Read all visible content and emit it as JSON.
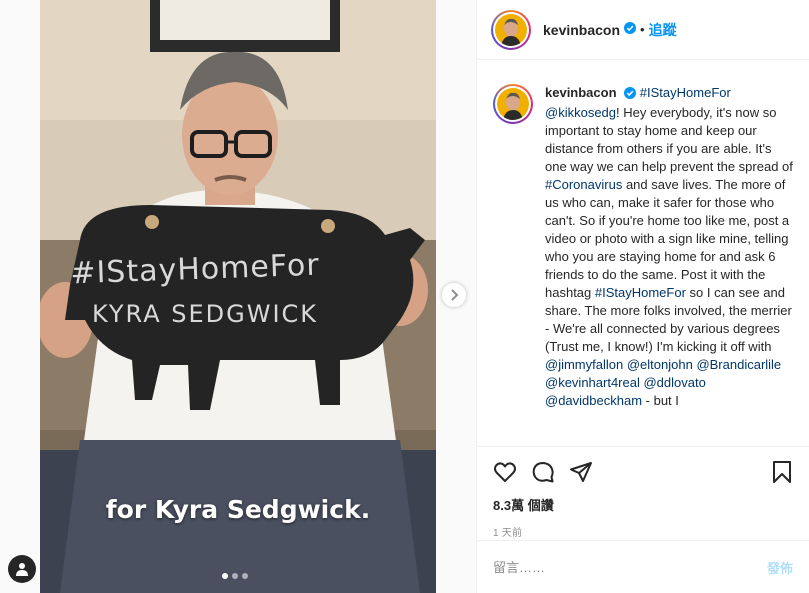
{
  "media": {
    "sign_line1": "#IStayHomeFor",
    "sign_line2": "KYRA SEDGWICK",
    "subtitle": "for Kyra Sedgwick.",
    "carousel_count": 3,
    "carousel_active": 1,
    "icons": {
      "next": "chevron-right-icon",
      "user_tag": "person-icon"
    }
  },
  "header": {
    "username": "kevinbacon",
    "separator": "•",
    "follow_label": "追蹤",
    "verified_color": "#0095f6"
  },
  "caption": {
    "username": "kevinbacon",
    "parts": [
      {
        "t": "link",
        "v": "#IStayHomeFor"
      },
      {
        "t": "text",
        "v": " "
      },
      {
        "t": "link",
        "v": "@kikkosedg"
      },
      {
        "t": "text",
        "v": "! Hey everybody, it's now so important to stay home and keep our distance from others if you are able. It's one way we can help prevent the spread of "
      },
      {
        "t": "link",
        "v": "#Coronavirus"
      },
      {
        "t": "text",
        "v": " and save lives. The more of us who can, make it safer for those who can't. So if you're home too like me, post a video or photo with a sign like mine, telling who you are staying home for and ask 6 friends to do the same. Post it with the hashtag "
      },
      {
        "t": "link",
        "v": "#IStayHomeFor"
      },
      {
        "t": "text",
        "v": " so I can see and share. The more folks involved, the merrier - We're all connected by various degrees (Trust me, I know!) I'm kicking it off with "
      },
      {
        "t": "link",
        "v": "@jimmyfallon"
      },
      {
        "t": "text",
        "v": " "
      },
      {
        "t": "link",
        "v": "@eltonjohn"
      },
      {
        "t": "text",
        "v": " "
      },
      {
        "t": "link",
        "v": "@Brandicarlile"
      },
      {
        "t": "text",
        "v": " "
      },
      {
        "t": "link",
        "v": "@kevinhart4real"
      },
      {
        "t": "text",
        "v": " "
      },
      {
        "t": "link",
        "v": "@ddlovato"
      },
      {
        "t": "text",
        "v": " "
      },
      {
        "t": "link",
        "v": "@davidbeckham"
      },
      {
        "t": "text",
        "v": " - but I"
      }
    ]
  },
  "actions": {
    "views_count": "8.3萬",
    "views_label": "個讚",
    "time_ago": "1 天前",
    "icons": [
      "heart-icon",
      "comment-icon",
      "share-icon",
      "bookmark-icon"
    ]
  },
  "comment_box": {
    "placeholder": "留言……",
    "post_label": "發佈"
  },
  "colors": {
    "link": "#00376b",
    "follow": "#0095f6",
    "post_disabled": "#b2dffc",
    "muted": "#8e8e8e"
  }
}
